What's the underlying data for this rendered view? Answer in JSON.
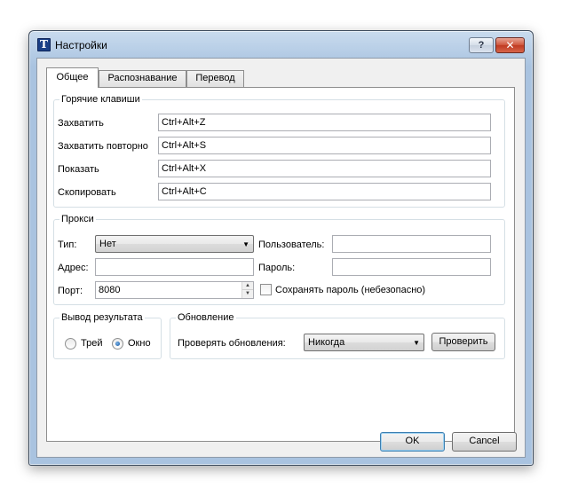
{
  "window": {
    "title": "Настройки",
    "app_icon_glyph": "T",
    "help_glyph": "?",
    "close_glyph": "✕"
  },
  "tabs": [
    {
      "label": "Общее",
      "active": true
    },
    {
      "label": "Распознавание",
      "active": false
    },
    {
      "label": "Перевод",
      "active": false
    }
  ],
  "hotkeys": {
    "group_title": "Горячие клавиши",
    "capture_label": "Захватить",
    "capture_value": "Ctrl+Alt+Z",
    "recapture_label": "Захватить повторно",
    "recapture_value": "Ctrl+Alt+S",
    "show_label": "Показать",
    "show_value": "Ctrl+Alt+X",
    "copy_label": "Скопировать",
    "copy_value": "Ctrl+Alt+C"
  },
  "proxy": {
    "group_title": "Прокси",
    "type_label": "Тип:",
    "type_value": "Нет",
    "user_label": "Пользователь:",
    "user_value": "",
    "address_label": "Адрес:",
    "address_value": "",
    "password_label": "Пароль:",
    "password_value": "",
    "port_label": "Порт:",
    "port_value": "8080",
    "save_password_label": "Сохранять пароль (небезопасно)",
    "save_password_checked": false
  },
  "output": {
    "group_title": "Вывод результата",
    "tray_label": "Трей",
    "tray_checked": false,
    "window_label": "Окно",
    "window_checked": true
  },
  "updates": {
    "group_title": "Обновление",
    "check_label": "Проверять обновления:",
    "check_value": "Никогда",
    "check_button": "Проверить"
  },
  "footer": {
    "ok_label": "OK",
    "cancel_label": "Cancel"
  },
  "colors": {
    "title_bar": "#b6cde6",
    "close_button": "#c94a33",
    "default_button_border": "#3c7fb1"
  }
}
